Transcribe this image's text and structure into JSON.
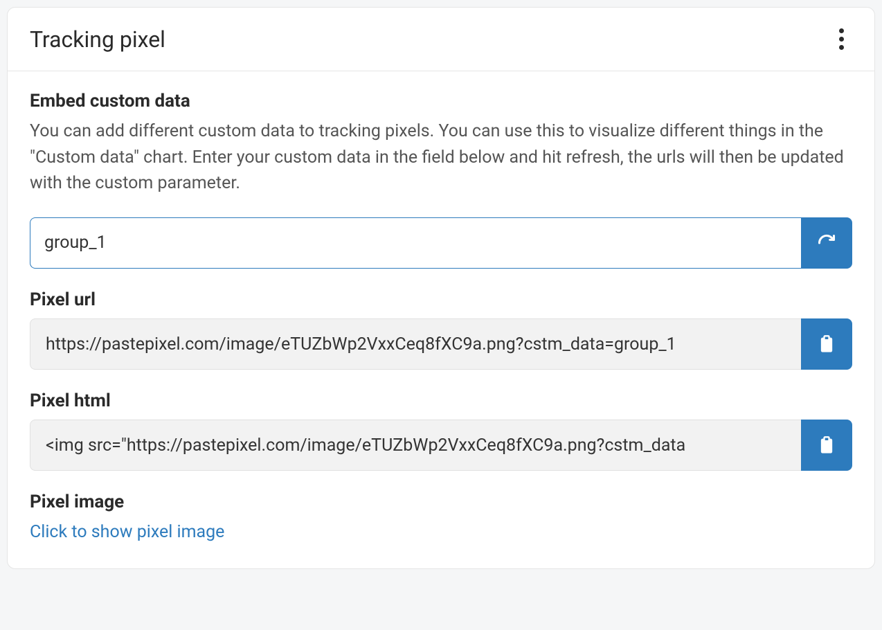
{
  "header": {
    "title": "Tracking pixel"
  },
  "embed": {
    "title": "Embed custom data",
    "description": "You can add different custom data to tracking pixels. You can use this to visualize different things in the \"Custom data\" chart. Enter your custom data in the field below and hit refresh, the urls will then be updated with the custom parameter.",
    "input_value": "group_1"
  },
  "pixel_url": {
    "label": "Pixel url",
    "value": "https://pastepixel.com/image/eTUZbWp2VxxCeq8fXC9a.png?cstm_data=group_1"
  },
  "pixel_html": {
    "label": "Pixel html",
    "value": "<img src=\"https://pastepixel.com/image/eTUZbWp2VxxCeq8fXC9a.png?cstm_data"
  },
  "pixel_image": {
    "label": "Pixel image",
    "link_text": "Click to show pixel image"
  }
}
